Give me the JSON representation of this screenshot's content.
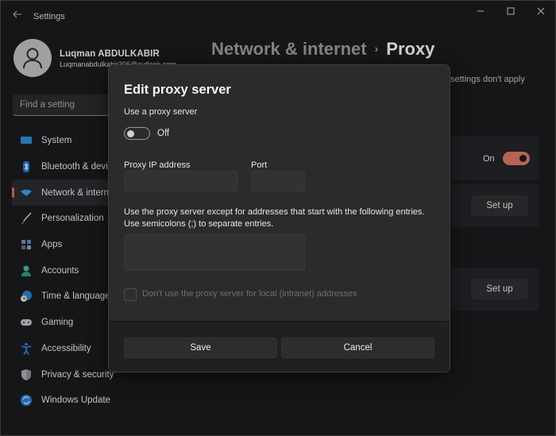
{
  "window": {
    "app_title": "Settings",
    "controls": {
      "minimize": "—",
      "maximize": "☐",
      "close": "✕"
    }
  },
  "profile": {
    "name": "Luqman ABDULKABIR",
    "email": "Luqmanabdulkabir306@outlook.com"
  },
  "search": {
    "placeholder": "Find a setting"
  },
  "nav": {
    "items": [
      {
        "label": "System",
        "icon": "system-icon",
        "active": false
      },
      {
        "label": "Bluetooth & devices",
        "icon": "bluetooth-icon",
        "active": false
      },
      {
        "label": "Network & internet",
        "icon": "wifi-icon",
        "active": true
      },
      {
        "label": "Personalization",
        "icon": "brush-icon",
        "active": false
      },
      {
        "label": "Apps",
        "icon": "apps-icon",
        "active": false
      },
      {
        "label": "Accounts",
        "icon": "accounts-icon",
        "active": false
      },
      {
        "label": "Time & language",
        "icon": "time-language-icon",
        "active": false
      },
      {
        "label": "Gaming",
        "icon": "gaming-icon",
        "active": false
      },
      {
        "label": "Accessibility",
        "icon": "accessibility-icon",
        "active": false
      },
      {
        "label": "Privacy & security",
        "icon": "shield-icon",
        "active": false
      },
      {
        "label": "Windows Update",
        "icon": "update-icon",
        "active": false
      }
    ]
  },
  "header": {
    "breadcrumb_parent": "Network & internet",
    "breadcrumb_separator": "›",
    "breadcrumb_current": "Proxy",
    "note": "settings don't apply"
  },
  "background_cards": {
    "auto_detect_toggle_label": "On",
    "auto_detect_toggle_state": true,
    "setup_script_button": "Set up",
    "manual_proxy_button": "Set up"
  },
  "dialog": {
    "title": "Edit proxy server",
    "use_proxy_label": "Use a proxy server",
    "use_proxy_state": false,
    "use_proxy_state_label": "Off",
    "proxy_ip_label": "Proxy IP address",
    "proxy_ip_value": "",
    "port_label": "Port",
    "port_value": "",
    "exceptions_label_line1": "Use the proxy server except for addresses that start with the following entries.",
    "exceptions_label_line2": "Use semicolons (;) to separate entries.",
    "exceptions_value": "",
    "local_checkbox_label": "Don't use the proxy server for local (intranet) addresses",
    "local_checkbox_checked": false,
    "save_label": "Save",
    "cancel_label": "Cancel"
  },
  "colors": {
    "accent": "#d97560",
    "background": "#1a1b1e",
    "dialog": "#2b2b2b"
  }
}
